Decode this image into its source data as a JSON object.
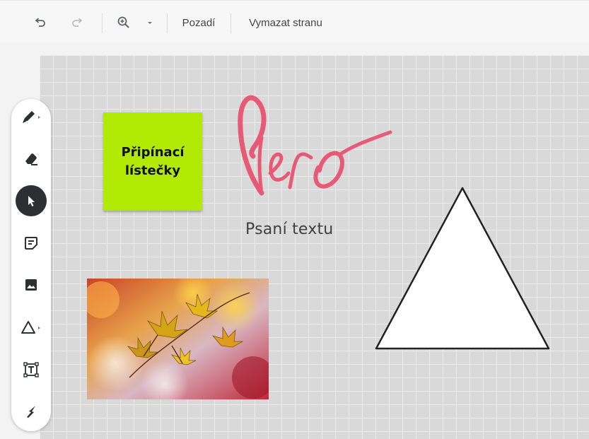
{
  "toolbar": {
    "undo_icon": "undo-icon",
    "redo_icon": "redo-icon",
    "zoom_icon": "zoom-in-icon",
    "zoom_dropdown_icon": "caret-down-icon",
    "background_label": "Pozadí",
    "clear_page_label": "Vymazat stranu"
  },
  "tools": [
    {
      "name": "pen-tool",
      "icon": "pen-icon",
      "has_submenu": true
    },
    {
      "name": "eraser-tool",
      "icon": "eraser-icon"
    },
    {
      "name": "select-tool",
      "icon": "cursor-arrow-icon",
      "active": true
    },
    {
      "name": "sticky-note-tool",
      "icon": "sticky-note-icon"
    },
    {
      "name": "image-tool",
      "icon": "image-icon"
    },
    {
      "name": "shape-tool",
      "icon": "triangle-shape-icon",
      "has_submenu": true
    },
    {
      "name": "text-box-tool",
      "icon": "text-box-icon"
    },
    {
      "name": "laser-tool",
      "icon": "laser-icon"
    }
  ],
  "canvas": {
    "sticky_note": {
      "line1": "Připínací",
      "line2": "lístečky",
      "color": "#b2ea06"
    },
    "handwriting": {
      "text": "Pero",
      "color": "#e8506e"
    },
    "text_object": "Psaní textu",
    "shape": "triangle",
    "image": "autumn-maple-leaves"
  },
  "colors": {
    "active_tool": "#2d2f33",
    "canvas_bg": "#d9d9d9"
  }
}
